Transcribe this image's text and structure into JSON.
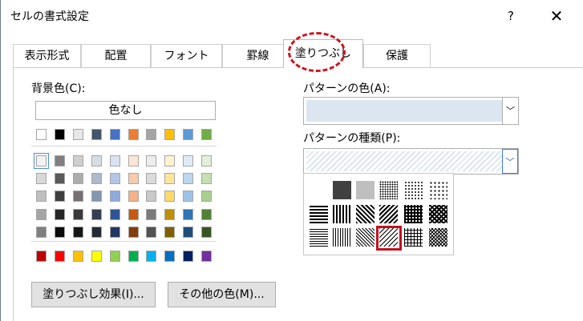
{
  "window": {
    "title": "セルの書式設定",
    "help_icon": "?",
    "close_icon": "✕"
  },
  "tabs": [
    {
      "label": "表示形式",
      "active": false
    },
    {
      "label": "配置",
      "active": false
    },
    {
      "label": "フォント",
      "active": false
    },
    {
      "label": "罫線",
      "active": false
    },
    {
      "label": "塗りつぶし",
      "active": true
    },
    {
      "label": "保護",
      "active": false
    }
  ],
  "background_color": {
    "label": "背景色(C):",
    "no_color_button": "色なし",
    "top_row": [
      "#ffffff",
      "#000000",
      "#e7e6e6",
      "#44546a",
      "#4472c4",
      "#ed7d31",
      "#a5a5a5",
      "#ffc000",
      "#5b9bd5",
      "#70ad47"
    ],
    "theme_shades": [
      [
        "#f2f2f2",
        "#7f7f7f",
        "#d0cece",
        "#d6dce4",
        "#d9e2f3",
        "#fbe5d5",
        "#ededed",
        "#fff2cc",
        "#deebf6",
        "#e2efd9"
      ],
      [
        "#d8d8d8",
        "#595959",
        "#aeabab",
        "#adb9ca",
        "#b4c6e7",
        "#f7cbac",
        "#dbdbdb",
        "#fee599",
        "#bdd7ee",
        "#c5e0b3"
      ],
      [
        "#bfbfbf",
        "#3f3f3f",
        "#757070",
        "#8496b0",
        "#8eaadb",
        "#f4b183",
        "#c9c9c9",
        "#ffd965",
        "#9cc3e5",
        "#a8d08d"
      ],
      [
        "#a5a5a5",
        "#262626",
        "#3a3838",
        "#333f4f",
        "#2f5496",
        "#c55a11",
        "#7b7b7b",
        "#bf9000",
        "#2e75b5",
        "#538135"
      ],
      [
        "#7f7f7f",
        "#0c0c0c",
        "#171616",
        "#222a35",
        "#1f3864",
        "#833c0b",
        "#525252",
        "#7f6000",
        "#1e4e79",
        "#375623"
      ]
    ],
    "standard_colors": [
      "#c00000",
      "#ff0000",
      "#ffc000",
      "#ffff00",
      "#92d050",
      "#00b050",
      "#00b0f0",
      "#0070c0",
      "#002060",
      "#7030a0"
    ]
  },
  "pattern_color": {
    "label": "パターンの色(A):",
    "value_color": "#dce6f0"
  },
  "pattern_style": {
    "label": "パターンの種類(P):"
  },
  "buttons": {
    "fill_effects": "塗りつぶし効果(I)...",
    "more_colors": "その他の色(M)..."
  },
  "accent": {
    "highlight": "#c1121f",
    "selected_outline": "#4f8fd8"
  }
}
